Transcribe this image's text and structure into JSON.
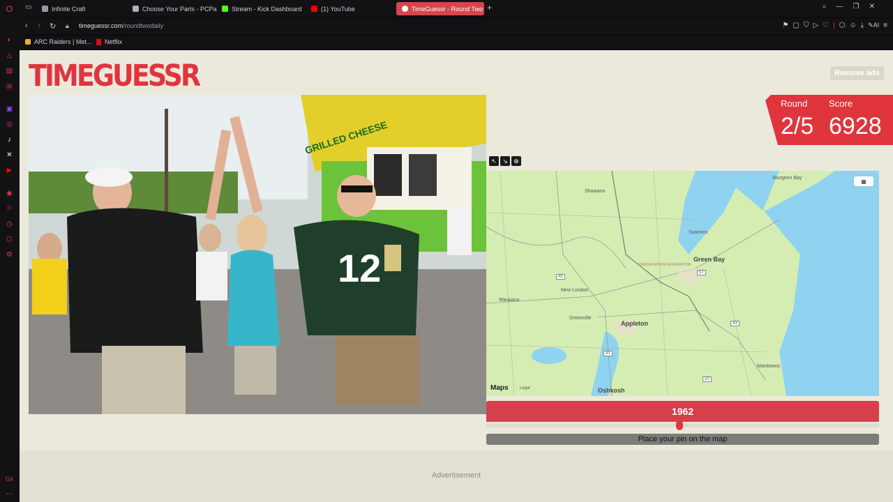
{
  "browser": {
    "tabs": [
      {
        "label": "Infinite Craft",
        "color": "#9a9aa2"
      },
      {
        "label": "Choose Your Parts - PCPa",
        "color": "#b0b0b8"
      },
      {
        "label": "Stream - Kick Dashboard",
        "color": "#53fc18"
      },
      {
        "label": "(1) YouTube",
        "color": "#ff0000"
      },
      {
        "label": "TimeGuessr - Round Two",
        "color": "#ffffff"
      }
    ],
    "url_host": "timeguessr.com",
    "url_path": "/roundtwodaily",
    "bookmarks": [
      {
        "label": "ARC Raiders | Met...",
        "color": "#f2a93b"
      },
      {
        "label": "Netflix",
        "color": "#e50914"
      }
    ],
    "ai_label": "AI"
  },
  "page": {
    "logo": "TIMEGUESSR",
    "remove_ads": "Remove ads",
    "round_label": "Round",
    "round_value": "2/5",
    "score_label": "Score",
    "score_value": "6928",
    "photo_sign_text": "GRILLED CHEESE",
    "photo_jersey_number": "12",
    "map": {
      "attribution": "Maps",
      "legal": "Legal",
      "places": [
        "Shawano",
        "Sturgeon Bay",
        "Suamico",
        "Green Bay",
        "ONEIDA NATION RESERVATION",
        "New London",
        "Waupaca",
        "Greenville",
        "Appleton",
        "Manitowoc",
        "Oshkosh"
      ],
      "routes": [
        "45",
        "41",
        "43",
        "57",
        "10"
      ]
    },
    "year": "1962",
    "year_fraction": 0.492,
    "place_pin": "Place your pin on the map",
    "advertisement": "Advertisement"
  }
}
